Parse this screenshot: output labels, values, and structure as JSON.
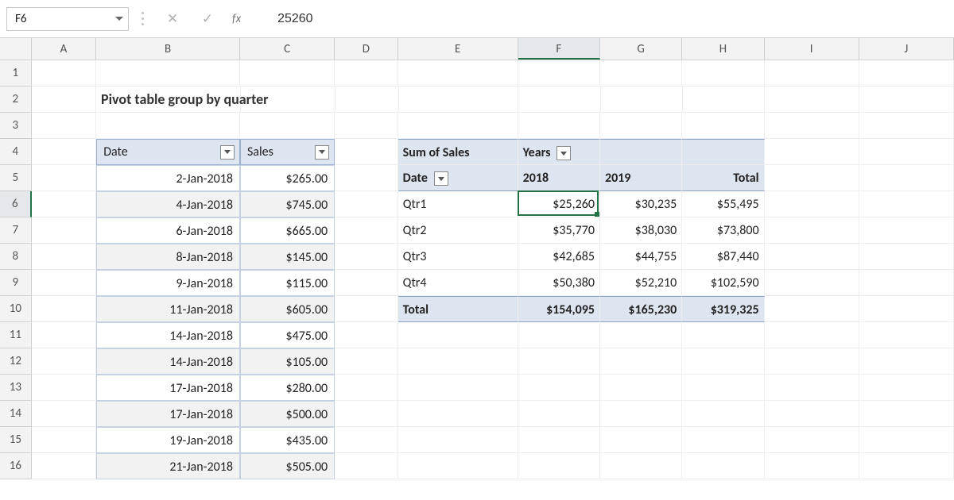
{
  "name_box": "F6",
  "formula_value": "25260",
  "fx_label": "fx",
  "check_glyph": "✓",
  "x_glyph": "✕",
  "columns": [
    "A",
    "B",
    "C",
    "D",
    "E",
    "F",
    "G",
    "H",
    "I",
    "J"
  ],
  "rows": [
    "1",
    "2",
    "3",
    "4",
    "5",
    "6",
    "7",
    "8",
    "9",
    "10",
    "11",
    "12",
    "13",
    "14",
    "15",
    "16"
  ],
  "title": "Pivot table group by quarter",
  "table_headers": {
    "date": "Date",
    "sales": "Sales"
  },
  "table_rows": [
    {
      "date": "2-Jan-2018",
      "sales": "$265.00"
    },
    {
      "date": "4-Jan-2018",
      "sales": "$745.00"
    },
    {
      "date": "6-Jan-2018",
      "sales": "$665.00"
    },
    {
      "date": "8-Jan-2018",
      "sales": "$145.00"
    },
    {
      "date": "9-Jan-2018",
      "sales": "$115.00"
    },
    {
      "date": "11-Jan-2018",
      "sales": "$605.00"
    },
    {
      "date": "14-Jan-2018",
      "sales": "$475.00"
    },
    {
      "date": "14-Jan-2018",
      "sales": "$105.00"
    },
    {
      "date": "17-Jan-2018",
      "sales": "$280.00"
    },
    {
      "date": "17-Jan-2018",
      "sales": "$500.00"
    },
    {
      "date": "19-Jan-2018",
      "sales": "$435.00"
    },
    {
      "date": "21-Jan-2018",
      "sales": "$505.00"
    }
  ],
  "pivot": {
    "measure": "Sum of Sales",
    "cols_label": "Years",
    "row_label": "Date",
    "col_headers": [
      "2018",
      "2019",
      "Total"
    ],
    "rows": [
      {
        "label": "Qtr1",
        "vals": [
          "$25,260",
          "$30,235",
          "$55,495"
        ]
      },
      {
        "label": "Qtr2",
        "vals": [
          "$35,770",
          "$38,030",
          "$73,800"
        ]
      },
      {
        "label": "Qtr3",
        "vals": [
          "$42,685",
          "$44,755",
          "$87,440"
        ]
      },
      {
        "label": "Qtr4",
        "vals": [
          "$50,380",
          "$52,210",
          "$102,590"
        ]
      }
    ],
    "total_label": "Total",
    "totals": [
      "$154,095",
      "$165,230",
      "$319,325"
    ]
  },
  "chart_data": {
    "type": "table",
    "title": "Pivot table group by quarter — Sum of Sales by Year",
    "categories": [
      "Qtr1",
      "Qtr2",
      "Qtr3",
      "Qtr4"
    ],
    "series": [
      {
        "name": "2018",
        "values": [
          25260,
          35770,
          42685,
          50380
        ]
      },
      {
        "name": "2019",
        "values": [
          30235,
          38030,
          44755,
          52210
        ]
      },
      {
        "name": "Total",
        "values": [
          55495,
          73800,
          87440,
          102590
        ]
      }
    ],
    "column_totals": {
      "2018": 154095,
      "2019": 165230,
      "Total": 319325
    }
  }
}
